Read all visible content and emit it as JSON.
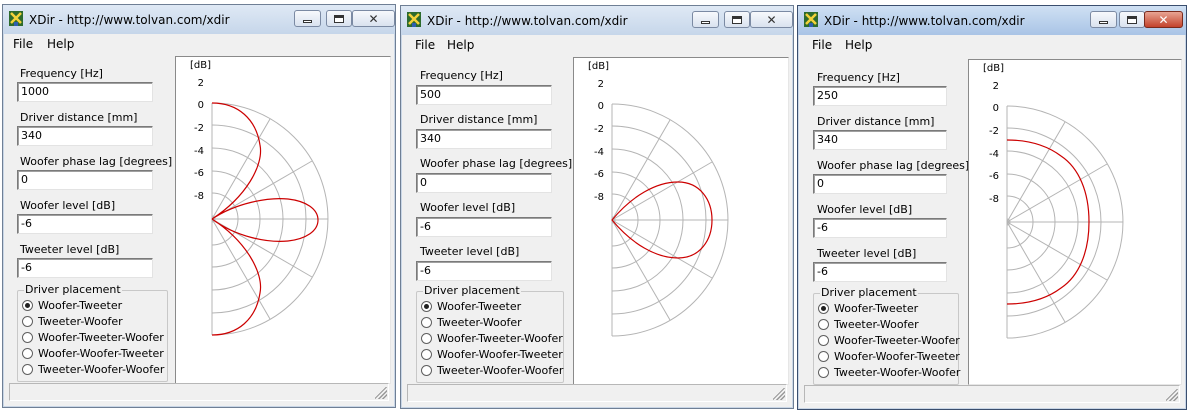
{
  "colors": {
    "curve": "#cc0000",
    "grid": "#b4b4b4"
  },
  "windows": [
    {
      "title": "XDir - http://www.tolvan.com/xdir",
      "menu": [
        "File",
        "Help"
      ],
      "frequency_label": "Frequency [Hz]",
      "frequency": "1000",
      "distance_label": "Driver distance [mm]",
      "distance": "340",
      "phase_label": "Woofer phase lag [degrees]",
      "phase": "0",
      "woofer_label": "Woofer level [dB]",
      "woofer": "-6",
      "tweeter_label": "Tweeter level [dB]",
      "tweeter": "-6",
      "placement_label": "Driver placement",
      "placements": [
        "Woofer-Tweeter",
        "Tweeter-Woofer",
        "Woofer-Tweeter-Woofer",
        "Woofer-Woofer-Tweeter",
        "Tweeter-Woofer-Woofer"
      ],
      "selected_placement": "Woofer-Tweeter",
      "axis": {
        "unit": "[dB]",
        "ticks": [
          "2",
          "0",
          "-2",
          "-4",
          "-6",
          "-8"
        ]
      }
    },
    {
      "title": "XDir - http://www.tolvan.com/xdir",
      "menu": [
        "File",
        "Help"
      ],
      "frequency_label": "Frequency [Hz]",
      "frequency": "500",
      "distance_label": "Driver distance [mm]",
      "distance": "340",
      "phase_label": "Woofer phase lag [degrees]",
      "phase": "0",
      "woofer_label": "Woofer level [dB]",
      "woofer": "-6",
      "tweeter_label": "Tweeter level [dB]",
      "tweeter": "-6",
      "placement_label": "Driver placement",
      "placements": [
        "Woofer-Tweeter",
        "Tweeter-Woofer",
        "Woofer-Tweeter-Woofer",
        "Woofer-Woofer-Tweeter",
        "Tweeter-Woofer-Woofer"
      ],
      "selected_placement": "Woofer-Tweeter",
      "axis": {
        "unit": "[dB]",
        "ticks": [
          "2",
          "0",
          "-2",
          "-4",
          "-6",
          "-8"
        ]
      }
    },
    {
      "title": "XDir - http://www.tolvan.com/xdir",
      "menu": [
        "File",
        "Help"
      ],
      "frequency_label": "Frequency [Hz]",
      "frequency": "250",
      "distance_label": "Driver distance [mm]",
      "distance": "340",
      "phase_label": "Woofer phase lag [degrees]",
      "phase": "0",
      "woofer_label": "Woofer level [dB]",
      "woofer": "-6",
      "tweeter_label": "Tweeter level [dB]",
      "tweeter": "-6",
      "placement_label": "Driver placement",
      "placements": [
        "Woofer-Tweeter",
        "Tweeter-Woofer",
        "Woofer-Tweeter-Woofer",
        "Woofer-Woofer-Tweeter",
        "Tweeter-Woofer-Woofer"
      ],
      "selected_placement": "Woofer-Tweeter",
      "axis": {
        "unit": "[dB]",
        "ticks": [
          "2",
          "0",
          "-2",
          "-4",
          "-6",
          "-8"
        ]
      }
    }
  ]
}
